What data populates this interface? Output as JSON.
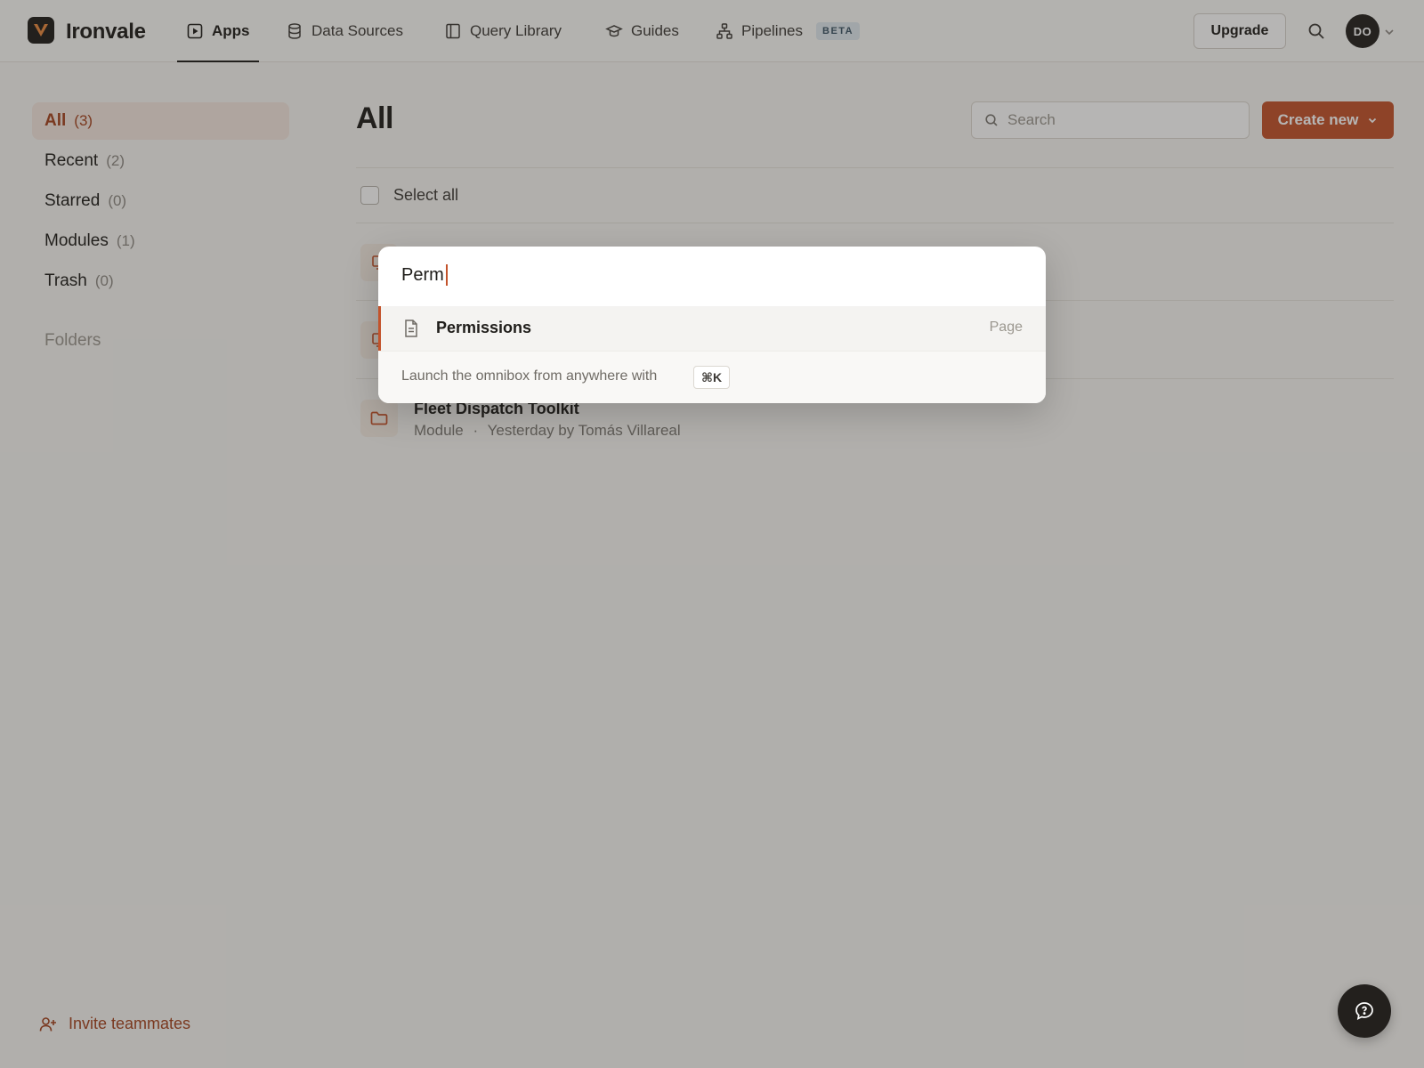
{
  "app": {
    "brand": "Ironvale"
  },
  "nav": {
    "items": [
      {
        "label": "Apps",
        "icon": "play-square-icon",
        "active": true
      },
      {
        "label": "Data Sources",
        "icon": "database-icon"
      },
      {
        "label": "Query Library",
        "icon": "book-icon"
      },
      {
        "label": "Guides",
        "icon": "graduation-cap-icon"
      },
      {
        "label": "Pipelines",
        "icon": "workflow-icon",
        "badge": "BETA"
      }
    ],
    "upgrade_label": "Upgrade",
    "avatar_initials": "DO"
  },
  "sidebar": {
    "items": [
      {
        "label": "All",
        "count": "(3)",
        "active": true
      },
      {
        "label": "Recent",
        "count": "(2)"
      },
      {
        "label": "Starred",
        "count": "(0)"
      },
      {
        "label": "Modules",
        "count": "(1)"
      },
      {
        "label": "Trash",
        "count": "(0)"
      }
    ],
    "folders_label": "Folders",
    "invite_label": "Invite teammates"
  },
  "main": {
    "title": "All",
    "search_placeholder": "Search",
    "create_label": "Create new",
    "select_all_label": "Select all",
    "rows": [
      {
        "title": "Fleet Dispatch Toolkit",
        "type": "Module",
        "separator": "·",
        "meta": "Yesterday by Tomás Villareal"
      }
    ]
  },
  "omnibox": {
    "query": "Perm",
    "results": [
      {
        "label": "Permissions",
        "kind": "Page"
      }
    ],
    "hint": "Launch the omnibox from anywhere with",
    "shortcut": "⌘K"
  },
  "colors": {
    "accent": "#c3532b",
    "overlay": "rgba(40,38,35,0.34)"
  }
}
